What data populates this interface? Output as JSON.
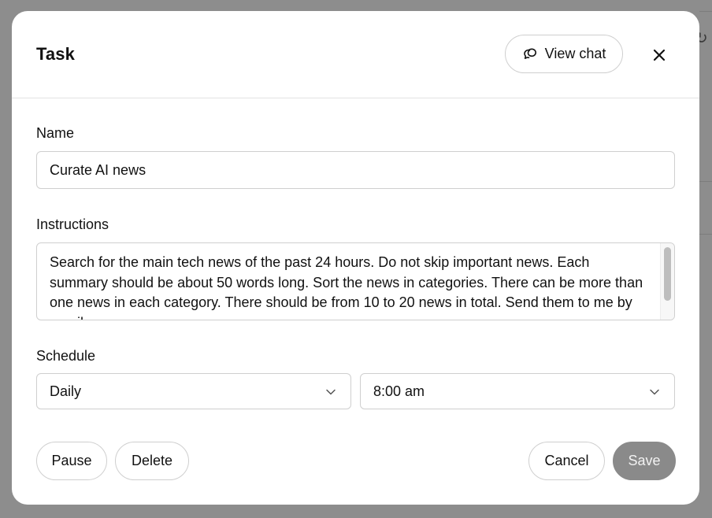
{
  "dialog": {
    "title": "Task",
    "view_chat_label": "View chat",
    "close_icon": "close-icon"
  },
  "name": {
    "label": "Name",
    "value": "Curate AI news"
  },
  "instructions": {
    "label": "Instructions",
    "value": "Search for the main tech news of the past 24 hours. Do not skip important news. Each summary should be about 50 words long. Sort the news in categories. There can be more than one news in each category. There should be from 10 to 20 news in total. Send them to me by email."
  },
  "schedule": {
    "label": "Schedule",
    "frequency": "Daily",
    "time": "8:00 am"
  },
  "actions": {
    "pause_label": "Pause",
    "delete_label": "Delete",
    "cancel_label": "Cancel",
    "save_label": "Save"
  },
  "colors": {
    "backdrop": "#8d8d8d",
    "save_disabled": "#8a8a8a",
    "border": "#cfcfcf"
  }
}
